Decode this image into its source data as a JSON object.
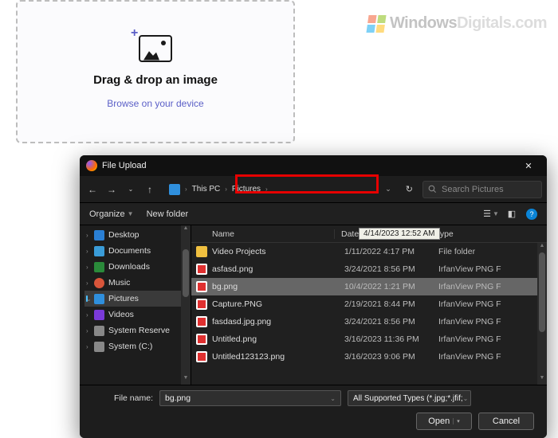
{
  "watermark": {
    "text_a": "Windows",
    "text_b": "Digitals.com"
  },
  "dropzone": {
    "title": "Drag & drop an image",
    "browse": "Browse on your device"
  },
  "dialog": {
    "title": "File Upload",
    "breadcrumb": {
      "root": "This PC",
      "folder": "Pictures"
    },
    "search_placeholder": "Search Pictures",
    "toolbar": {
      "organize": "Organize",
      "newfolder": "New folder"
    },
    "sidebar": [
      {
        "label": "Desktop",
        "sel": false,
        "icon": "ic-desktop"
      },
      {
        "label": "Documents",
        "sel": false,
        "icon": "ic-docs"
      },
      {
        "label": "Downloads",
        "sel": false,
        "icon": "ic-down"
      },
      {
        "label": "Music",
        "sel": false,
        "icon": "ic-music"
      },
      {
        "label": "Pictures",
        "sel": true,
        "icon": "ic-pic"
      },
      {
        "label": "Videos",
        "sel": false,
        "icon": "ic-vid"
      },
      {
        "label": "System Reserve",
        "sel": false,
        "icon": "ic-res"
      },
      {
        "label": "System (C:)",
        "sel": false,
        "icon": "ic-sys"
      }
    ],
    "columns": {
      "name": "Name",
      "date": "Date modified",
      "type": "Type"
    },
    "date_tooltip": "4/14/2023 12:52 AM",
    "files": [
      {
        "name": "Video Projects",
        "date": "1/11/2022 4:17 PM",
        "type": "File folder",
        "icon": "folder",
        "sel": false
      },
      {
        "name": "asfasd.png",
        "date": "3/24/2021 8:56 PM",
        "type": "IrfanView PNG F",
        "icon": "iv",
        "sel": false
      },
      {
        "name": "bg.png",
        "date": "10/4/2022 1:21 PM",
        "type": "IrfanView PNG F",
        "icon": "iv",
        "sel": true
      },
      {
        "name": "Capture.PNG",
        "date": "2/19/2021 8:44 PM",
        "type": "IrfanView PNG F",
        "icon": "iv",
        "sel": false
      },
      {
        "name": "fasdasd.jpg.png",
        "date": "3/24/2021 8:56 PM",
        "type": "IrfanView PNG F",
        "icon": "iv",
        "sel": false
      },
      {
        "name": "Untitled.png",
        "date": "3/16/2023 11:36 PM",
        "type": "IrfanView PNG F",
        "icon": "iv",
        "sel": false
      },
      {
        "name": "Untitled123123.png",
        "date": "3/16/2023 9:06 PM",
        "type": "IrfanView PNG F",
        "icon": "iv",
        "sel": false
      }
    ],
    "footer": {
      "filename_label": "File name:",
      "filename_value": "bg.png",
      "filter": "All Supported Types (*.jpg;*.jfif;",
      "open": "Open",
      "cancel": "Cancel"
    }
  }
}
